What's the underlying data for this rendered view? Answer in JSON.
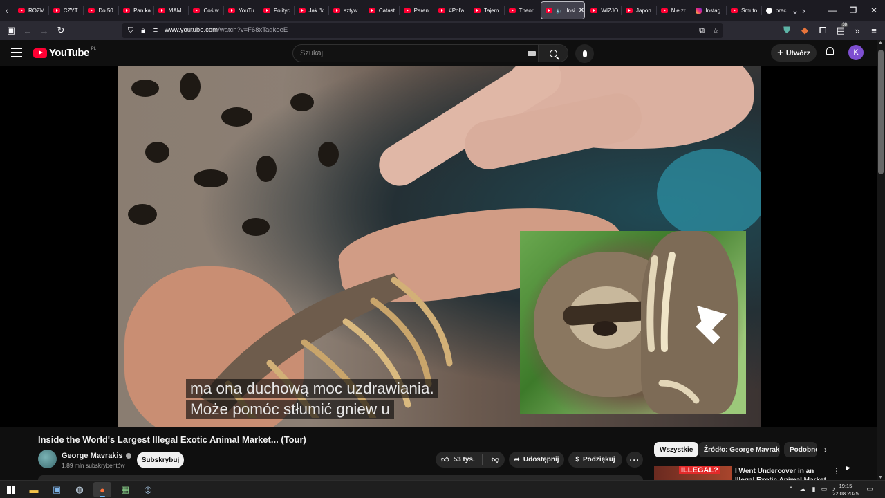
{
  "browser": {
    "tabs": [
      {
        "label": "ROZM",
        "icon": "unknown-favicon"
      },
      {
        "label": "CZYT",
        "icon": "youtube-favicon"
      },
      {
        "label": "Do 50",
        "icon": "youtube-favicon"
      },
      {
        "label": "Pan ka",
        "icon": "youtube-favicon"
      },
      {
        "label": "MAM",
        "icon": "youtube-favicon"
      },
      {
        "label": "Coś w",
        "icon": "youtube-favicon"
      },
      {
        "label": "YouTu",
        "icon": "youtube-favicon"
      },
      {
        "label": "Polityc",
        "icon": "youtube-favicon"
      },
      {
        "label": "Jak \"k",
        "icon": "youtube-favicon"
      },
      {
        "label": "sztyw",
        "icon": "youtube-favicon"
      },
      {
        "label": "Catast",
        "icon": "youtube-favicon"
      },
      {
        "label": "Paren",
        "icon": "youtube-favicon"
      },
      {
        "label": "#Pol'a",
        "icon": "youtube-favicon"
      },
      {
        "label": "Tajem",
        "icon": "youtube-favicon"
      },
      {
        "label": "Theor",
        "icon": "youtube-favicon"
      }
    ],
    "active_tab": {
      "label": "Insi",
      "icon": "youtube-favicon",
      "audio_icon": "speaker-icon",
      "close": "✕"
    },
    "tabs_after": [
      {
        "label": "WIZJO",
        "icon": "youtube-favicon"
      },
      {
        "label": "Japon",
        "icon": "youtube-favicon"
      },
      {
        "label": "Nie zr",
        "icon": "youtube-favicon"
      },
      {
        "label": "Instag",
        "icon": "instagram-favicon"
      },
      {
        "label": "Smutn",
        "icon": "youtube-favicon"
      },
      {
        "label": "prec",
        "icon": "google-favicon"
      }
    ],
    "url_host": "www.youtube.com",
    "url_path": "/watch?v=F68xTagkoeE",
    "extension_badge": "38"
  },
  "youtube": {
    "logo_text": "YouTube",
    "region": "PL",
    "search_placeholder": "Szukaj",
    "create_label": "Utwórz",
    "avatar_letter": "K"
  },
  "video": {
    "captions": [
      "ma ona duchową moc uzdrawiania.",
      "Może pomóc stłumić gniew u"
    ],
    "title": "Inside the World's Largest Illegal Exotic Animal Market... (Tour)",
    "channel_name": "George Mavrakis",
    "channel_subs": "1,89 mln subskrybentów",
    "subscribe_label": "Subskrybuj",
    "likes": "53 tys.",
    "share_label": "Udostępnij",
    "thanks_label": "Podziękuj",
    "more_label": "···"
  },
  "sidebar": {
    "chips": [
      "Wszystkie",
      "Źródło: George Mavrakis",
      "Podobne"
    ],
    "selected_chip": "Wszystkie",
    "next_recommendation": {
      "thumb_badge": "ILLEGAL?",
      "title": "I Went Undercover in an Illegal Exotic Animal Market"
    }
  },
  "taskbar": {
    "time": "19:15",
    "date": "22.08.2025"
  }
}
